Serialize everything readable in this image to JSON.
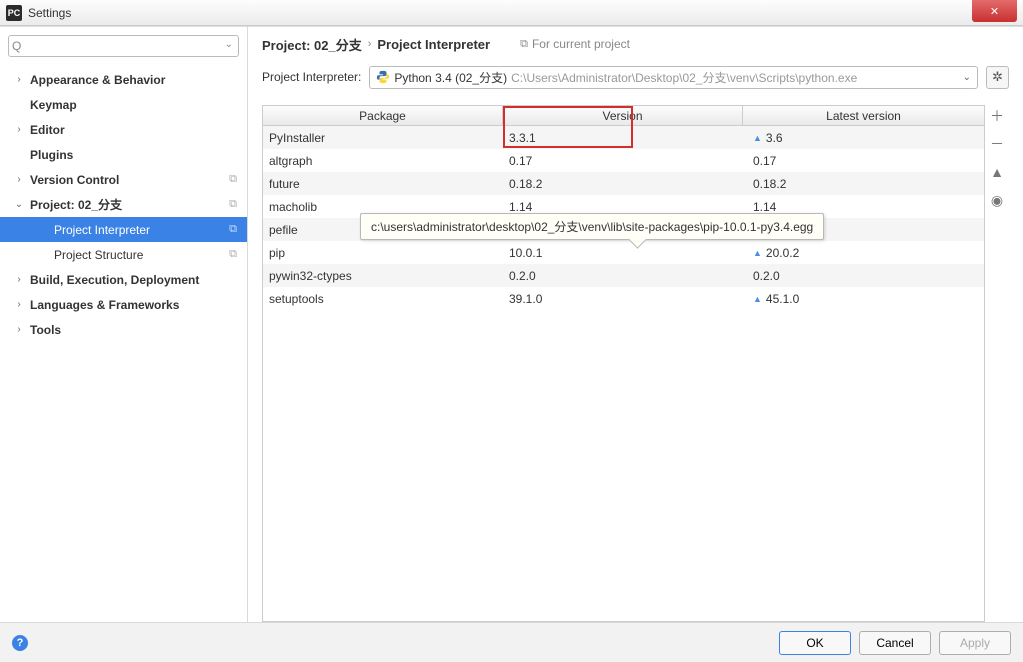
{
  "window": {
    "title": "Settings",
    "app_icon_text": "PC"
  },
  "search": {
    "placeholder": ""
  },
  "sidebar": {
    "items": [
      {
        "label": "Appearance & Behavior",
        "expandable": true,
        "bold": true
      },
      {
        "label": "Keymap",
        "expandable": false,
        "bold": true
      },
      {
        "label": "Editor",
        "expandable": true,
        "bold": true
      },
      {
        "label": "Plugins",
        "expandable": false,
        "bold": true
      },
      {
        "label": "Version Control",
        "expandable": true,
        "bold": true,
        "copy": true
      },
      {
        "label": "Project: 02_分支",
        "expandable": true,
        "expanded": true,
        "bold": true,
        "copy": true
      },
      {
        "label": "Project Interpreter",
        "child": true,
        "selected": true,
        "copy": true
      },
      {
        "label": "Project Structure",
        "child": true,
        "copy": true
      },
      {
        "label": "Build, Execution, Deployment",
        "expandable": true,
        "bold": true
      },
      {
        "label": "Languages & Frameworks",
        "expandable": true,
        "bold": true
      },
      {
        "label": "Tools",
        "expandable": true,
        "bold": true
      }
    ]
  },
  "breadcrumb": {
    "project": "Project: 02_分支",
    "page": "Project Interpreter",
    "hint": "For current project"
  },
  "interpreter": {
    "label": "Project Interpreter:",
    "name": "Python 3.4 (02_分支)",
    "path": "C:\\Users\\Administrator\\Desktop\\02_分支\\venv\\Scripts\\python.exe"
  },
  "table": {
    "headers": {
      "package": "Package",
      "version": "Version",
      "latest": "Latest version"
    },
    "rows": [
      {
        "package": "PyInstaller",
        "version": "3.3.1",
        "latest": "3.6",
        "upgrade": true
      },
      {
        "package": "altgraph",
        "version": "0.17",
        "latest": "0.17"
      },
      {
        "package": "future",
        "version": "0.18.2",
        "latest": "0.18.2"
      },
      {
        "package": "macholib",
        "version": "1.14",
        "latest": "1.14"
      },
      {
        "package": "pefile",
        "version": "",
        "latest": ""
      },
      {
        "package": "pip",
        "version": "10.0.1",
        "latest": "20.0.2",
        "upgrade": true
      },
      {
        "package": "pywin32-ctypes",
        "version": "0.2.0",
        "latest": "0.2.0"
      },
      {
        "package": "setuptools",
        "version": "39.1.0",
        "latest": "45.1.0",
        "upgrade": true
      }
    ]
  },
  "tooltip": {
    "text": "c:\\users\\administrator\\desktop\\02_分支\\venv\\lib\\site-packages\\pip-10.0.1-py3.4.egg"
  },
  "footer": {
    "ok": "OK",
    "cancel": "Cancel",
    "apply": "Apply"
  }
}
